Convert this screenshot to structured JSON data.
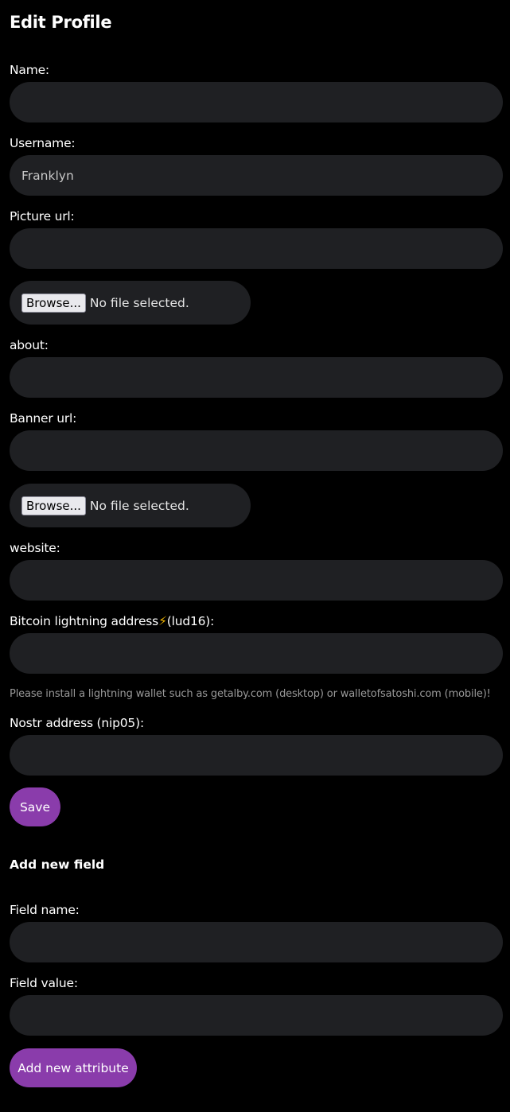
{
  "page_title": "Edit Profile",
  "fields": {
    "name": {
      "label": "Name:",
      "value": ""
    },
    "username": {
      "label": "Username:",
      "value": "Franklyn"
    },
    "picture_url": {
      "label": "Picture url:",
      "value": ""
    },
    "about": {
      "label": "about:",
      "value": ""
    },
    "banner_url": {
      "label": "Banner url:",
      "value": ""
    },
    "website": {
      "label": "website:",
      "value": ""
    },
    "lud16": {
      "label_prefix": "Bitcoin lightning address",
      "bolt": "⚡",
      "label_suffix": "(lud16):",
      "value": ""
    },
    "nip05": {
      "label": "Nostr address (nip05):",
      "value": ""
    }
  },
  "file_picker": {
    "browse_label": "Browse...",
    "status": "No file selected."
  },
  "lightning_hint": "Please install a lightning wallet such as getalby.com (desktop) or walletofsatoshi.com (mobile)!",
  "save_label": "Save",
  "new_field": {
    "heading": "Add new field",
    "name_label": "Field name:",
    "value_label": "Field value:",
    "button_label": "Add new attribute"
  },
  "colors": {
    "accent": "#8a3cab",
    "input_bg": "#1f2023",
    "background": "#000000"
  }
}
